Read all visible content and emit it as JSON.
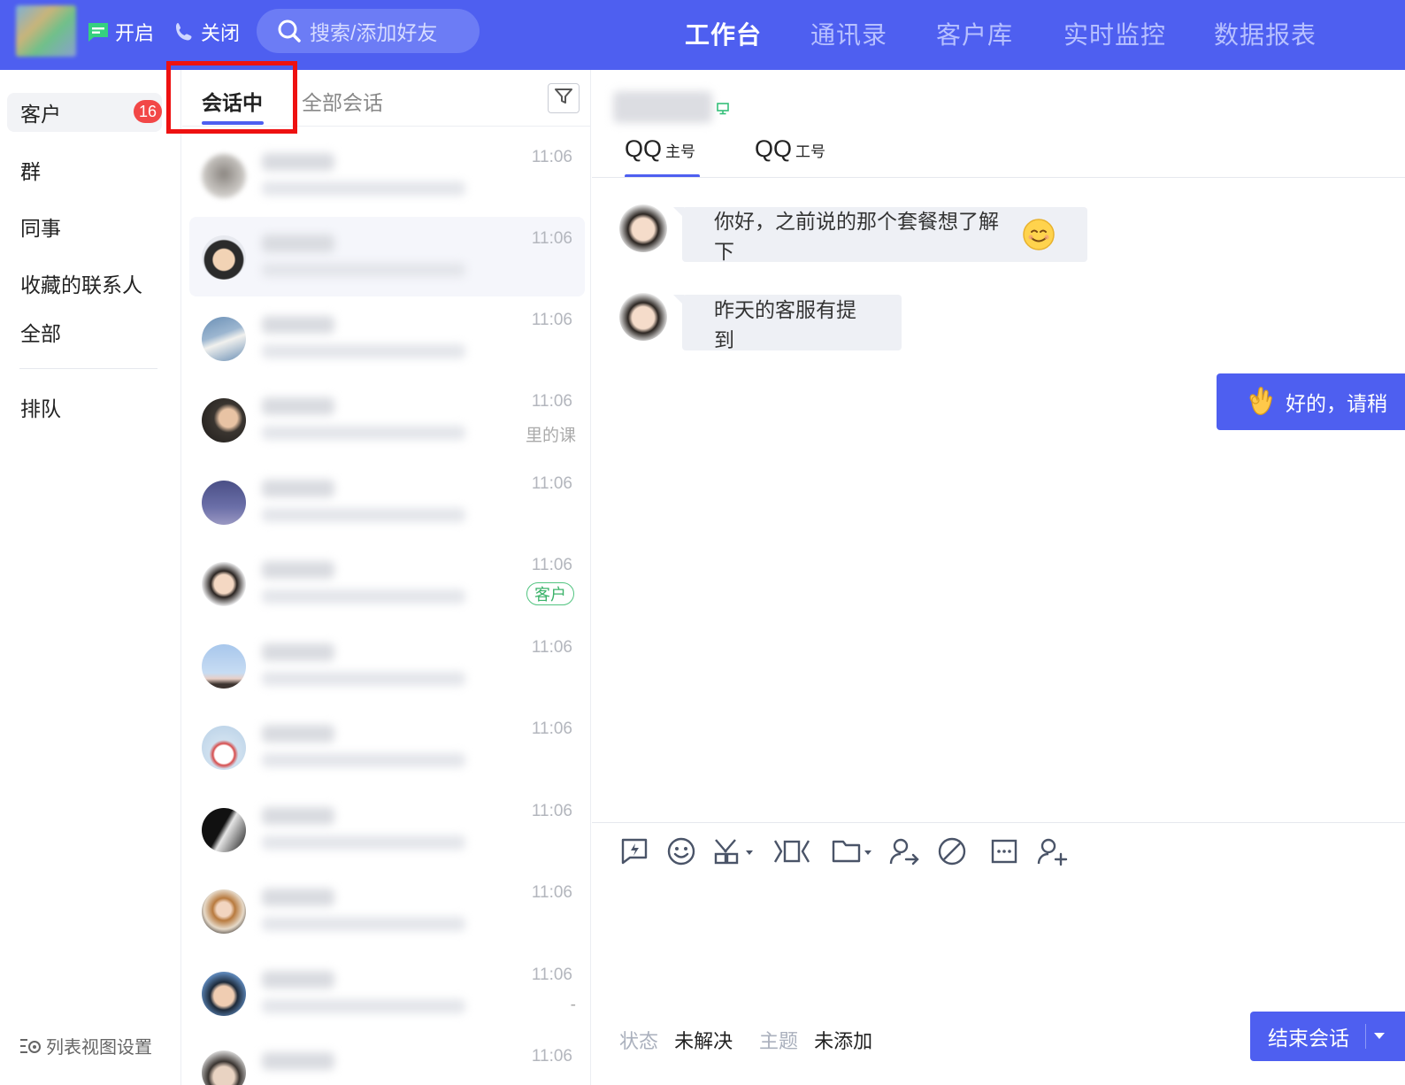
{
  "topbar": {
    "open_label": "开启",
    "close_label": "关闭",
    "search_placeholder": "搜索/添加好友",
    "nav": [
      "工作台",
      "通讯录",
      "客户库",
      "实时监控",
      "数据报表"
    ],
    "active_nav": "工作台",
    "brand_color": "#4e5ff0"
  },
  "sidebar": {
    "items": [
      {
        "label": "客户",
        "badge": "16"
      },
      {
        "label": "群"
      },
      {
        "label": "同事"
      },
      {
        "label": "收藏的联系人"
      },
      {
        "label": "全部"
      },
      {
        "label": "排队"
      }
    ],
    "list_settings": "列表视图设置"
  },
  "convlist": {
    "tabs": [
      "会话中",
      "全部会话"
    ],
    "active_tab": "会话中",
    "items": [
      {
        "time": "11:06",
        "avatar": "blurred-avatar"
      },
      {
        "time": "11:06",
        "avatar": "child-avatar",
        "selected": true
      },
      {
        "time": "11:06",
        "avatar": "goat-avatar"
      },
      {
        "time": "11:06",
        "avatar": "woman-avatar",
        "snippet": "里的课"
      },
      {
        "time": "11:06",
        "avatar": "night-sky-avatar"
      },
      {
        "time": "11:06",
        "avatar": "smiling-woman-avatar",
        "tag": "客户"
      },
      {
        "time": "11:06",
        "avatar": "balloon-girl-avatar"
      },
      {
        "time": "11:06",
        "avatar": "snowman-avatar"
      },
      {
        "time": "11:06",
        "avatar": "bw-portrait-avatar"
      },
      {
        "time": "11:06",
        "avatar": "camera-girl-avatar"
      },
      {
        "time": "11:06",
        "avatar": "headphones-man-avatar",
        "snippet": "-"
      },
      {
        "time": "11:06",
        "avatar": "partial-avatar"
      }
    ]
  },
  "chat": {
    "account_tabs": [
      {
        "name": "QQ",
        "suffix": "主号"
      },
      {
        "name": "QQ",
        "suffix": "工号"
      }
    ],
    "messages": [
      {
        "direction": "in",
        "text": "你好，之前说的那个套餐想了解下"
      },
      {
        "direction": "in",
        "text": "昨天的客服有提到"
      },
      {
        "direction": "out",
        "text": "好的，请稍"
      }
    ],
    "toolbar_icons": [
      "quick-reply-icon",
      "emoji-icon",
      "screenshot-icon",
      "video-icon",
      "folder-icon",
      "transfer-icon",
      "block-icon",
      "more-icon",
      "add-user-icon"
    ],
    "status_label": "状态",
    "status_value": "未解决",
    "topic_label": "主题",
    "topic_value": "未添加",
    "end_button": "结束会话"
  }
}
